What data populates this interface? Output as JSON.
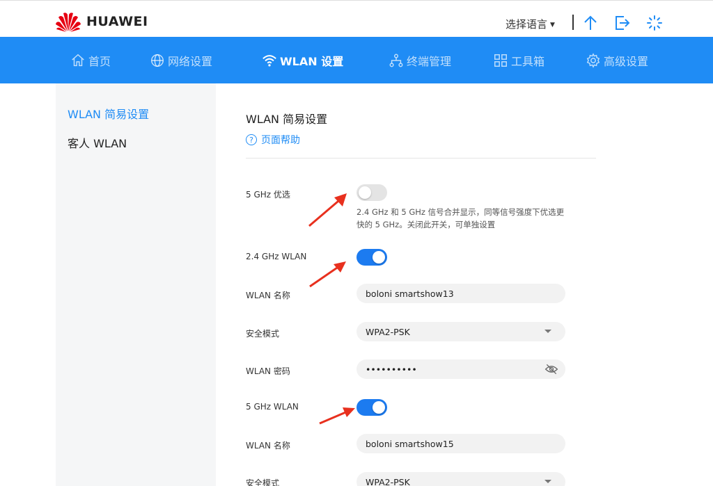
{
  "header": {
    "brand": "HUAWEI",
    "language_label": "选择语言",
    "brand_color": "#e60012"
  },
  "nav": {
    "items": [
      {
        "label": "首页",
        "icon": "home-icon"
      },
      {
        "label": "网络设置",
        "icon": "globe-icon"
      },
      {
        "label": "WLAN 设置",
        "icon": "wifi-icon",
        "active": true
      },
      {
        "label": "终端管理",
        "icon": "network-tree-icon"
      },
      {
        "label": "工具箱",
        "icon": "grid-icon"
      },
      {
        "label": "高级设置",
        "icon": "gear-icon"
      }
    ],
    "bg_color": "#1f8cf5"
  },
  "sidebar": {
    "items": [
      {
        "label": "WLAN 简易设置",
        "active": true
      },
      {
        "label": "客人 WLAN"
      }
    ]
  },
  "main": {
    "title": "WLAN 简易设置",
    "help_label": "页面帮助",
    "band_steering": {
      "label": "5 GHz 优选",
      "enabled": false,
      "hint": "2.4 GHz 和 5 GHz 信号合并显示，同等信号强度下优选更快的 5 GHz。关闭此开关，可单独设置"
    },
    "wlan24": {
      "label": "2.4 GHz WLAN",
      "enabled": true,
      "name_label": "WLAN 名称",
      "name_value": "boloni smartshow13",
      "security_label": "安全模式",
      "security_value": "WPA2-PSK",
      "password_label": "WLAN 密码",
      "password_value": "••••••••••"
    },
    "wlan5": {
      "label": "5 GHz WLAN",
      "enabled": true,
      "name_label": "WLAN 名称",
      "name_value": "boloni smartshow15",
      "security_label": "安全模式",
      "security_value": "WPA2-PSK"
    }
  }
}
